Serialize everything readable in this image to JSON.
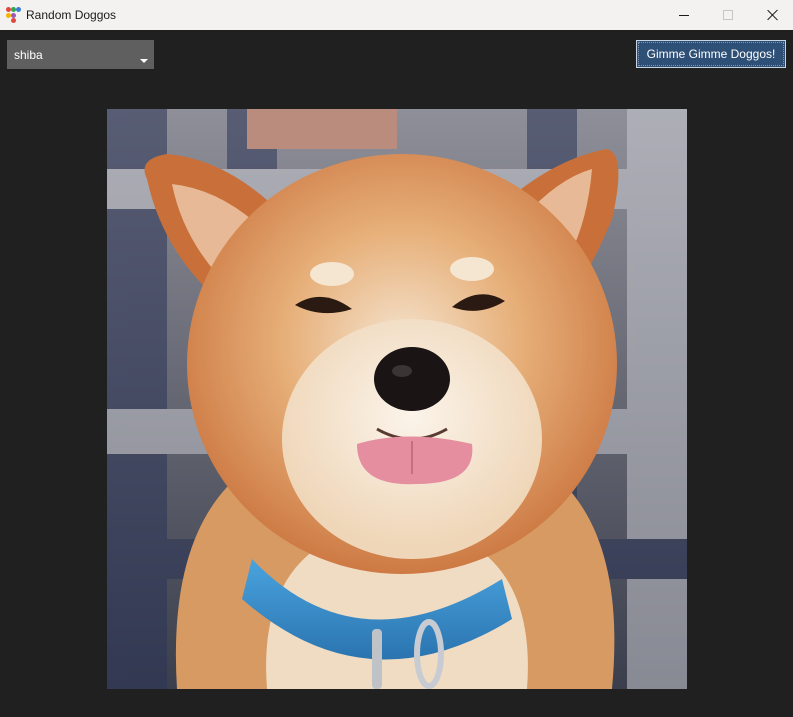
{
  "window": {
    "title": "Random Doggos",
    "icon": "app-icon",
    "controls": [
      "minimize-icon",
      "maximize-icon",
      "close-icon"
    ]
  },
  "toolbar": {
    "breed_select": {
      "selected": "shiba"
    },
    "fetch_button_label": "Gimme Gimme Doggos!"
  },
  "main": {
    "image_subject": "shiba inu dog with tongue out, blue collar"
  },
  "colors": {
    "background": "#202020",
    "titlebar": "#f3f2f0",
    "select_bg": "#5f5f5f",
    "button_bg": "#2e4f76"
  }
}
